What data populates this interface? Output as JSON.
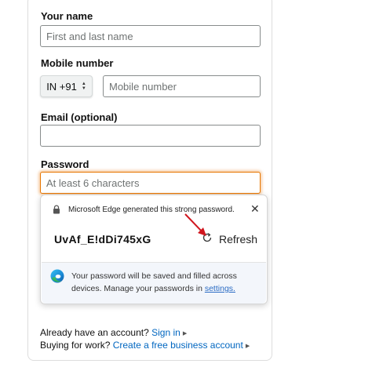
{
  "form": {
    "name_label": "Your name",
    "name_placeholder": "First and last name",
    "mobile_label": "Mobile number",
    "country_code": "IN +91",
    "mobile_placeholder": "Mobile number",
    "email_label": "Email (optional)",
    "email_value": "",
    "password_label": "Password",
    "password_placeholder": "At least 6 characters"
  },
  "password_popup": {
    "header": "Microsoft Edge generated this strong password.",
    "generated_password": "UvAf_E!dDi745xG",
    "refresh_label": "Refresh",
    "footer_text": "Your password will be saved and filled across devices. Manage your passwords in",
    "footer_link": "settings."
  },
  "bottom": {
    "signin_prompt": "Already have an account?",
    "signin_link": "Sign in",
    "business_prompt": "Buying for work?",
    "business_link": "Create a free business account"
  },
  "colors": {
    "focus_border": "#e77600",
    "link": "#0066c0",
    "annotation_arrow": "#d0161e"
  },
  "icons": {
    "lock": "lock-icon",
    "close": "close-icon",
    "refresh": "refresh-icon",
    "edge": "edge-icon",
    "caret": "caret-right-icon",
    "updown": "updown-icon",
    "annotation": "red-arrow-annotation"
  }
}
